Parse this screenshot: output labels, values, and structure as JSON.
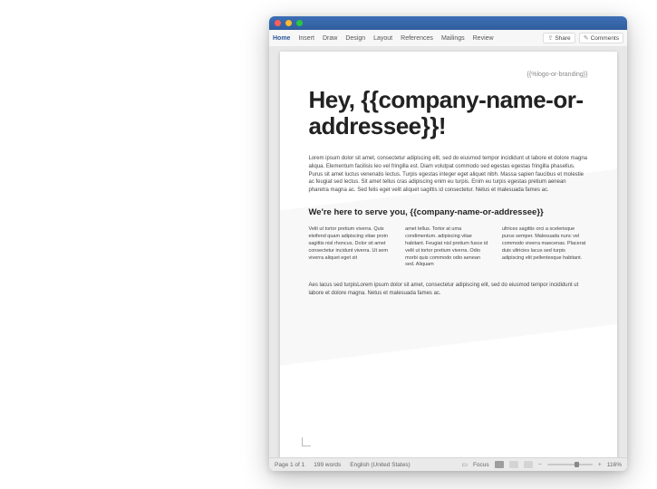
{
  "ribbon": {
    "tabs": [
      "Home",
      "Insert",
      "Draw",
      "Design",
      "Layout",
      "References",
      "Mailings",
      "Review"
    ],
    "share_label": "Share",
    "comments_label": "Comments"
  },
  "document": {
    "logo_placeholder": "{{%logo-or-branding}}",
    "heading": "Hey, {{company-name-or-addressee}}!",
    "intro_text": "Lorem ipsum dolor sit amet, consectetur adipiscing elit, sed do eiusmod tempor incididunt ut labore et dolore magna aliqua. Elementum facilisis leo vel fringilla est. Diam volutpat commodo sed egestas egestas fringilla phasellus. Purus sit amet luctus venenatis lectus. Turpis egestas integer eget aliquet nibh. Massa sapien faucibus et molestie ac feugiat sed lectus. Sit amet tellus cras adipiscing enim eu turpis. Enim eu turpis egestas pretium aenean pharetra magna ac. Sed felis eget velit aliquet sagittis id consectetur. Netus et malesuada fames ac.",
    "subheading": "We're here to serve you, {{company-name-or-addressee}}",
    "columns": {
      "c1": "Velit ut tortor pretium viverra. Quis eleifend quam adipiscing vitae proin sagittis nisl rhoncus. Dolor sit amet consectetur incidunt viverra. Ut sem viverra aliquet eget sit",
      "c2": "amet tellus. Tortor at uma condimentum. adipiscing vitae habitant. Feugiat nisl pretium fusce id velit ut tortor pretium viverra. Odio morbi quis commodo odio aenean sed. Aliquam",
      "c3": "ultrices sagittis orci a scelerisque purus semper. Malesuada nunc vel commodo viverra maecenas. Placerat duis ultricies lacus sed turpis adipiscing elit pellentesque habitant."
    },
    "outro_text": "Aes lacus sed turpisLorem ipsum dolor sit amet, consectetur adipiscing elit, sed do eiusmod tempor incididunt ut labore et dolore magna. Netus et malesuada fames ac."
  },
  "statusbar": {
    "page_info": "Page 1 of 1",
    "word_count": "199 words",
    "language": "English (United States)",
    "focus_label": "Focus",
    "zoom_pct": "116%"
  }
}
